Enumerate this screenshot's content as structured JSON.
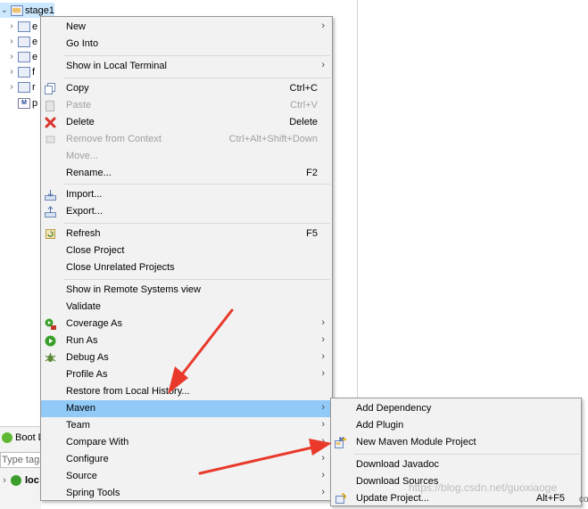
{
  "tree": {
    "root_label": "stage1",
    "items": [
      "e",
      "e",
      "e",
      "f",
      "r",
      "p"
    ]
  },
  "bottom": {
    "boot_tab": "Boot D",
    "type_tags_placeholder": "Type tags",
    "local_label": "loc"
  },
  "menu": {
    "new": {
      "label": "New"
    },
    "go_into": {
      "label": "Go Into"
    },
    "show_local_terminal": {
      "label": "Show in Local Terminal"
    },
    "copy": {
      "label": "Copy",
      "accel": "Ctrl+C"
    },
    "paste": {
      "label": "Paste",
      "accel": "Ctrl+V"
    },
    "delete": {
      "label": "Delete",
      "accel": "Delete"
    },
    "remove_context": {
      "label": "Remove from Context",
      "accel": "Ctrl+Alt+Shift+Down"
    },
    "move": {
      "label": "Move..."
    },
    "rename": {
      "label": "Rename...",
      "accel": "F2"
    },
    "import": {
      "label": "Import..."
    },
    "export": {
      "label": "Export..."
    },
    "refresh": {
      "label": "Refresh",
      "accel": "F5"
    },
    "close_project": {
      "label": "Close Project"
    },
    "close_unrelated": {
      "label": "Close Unrelated Projects"
    },
    "show_remote": {
      "label": "Show in Remote Systems view"
    },
    "validate": {
      "label": "Validate"
    },
    "coverage_as": {
      "label": "Coverage As"
    },
    "run_as": {
      "label": "Run As"
    },
    "debug_as": {
      "label": "Debug As"
    },
    "profile_as": {
      "label": "Profile As"
    },
    "restore_history": {
      "label": "Restore from Local History..."
    },
    "maven": {
      "label": "Maven"
    },
    "team": {
      "label": "Team"
    },
    "compare_with": {
      "label": "Compare With"
    },
    "configure": {
      "label": "Configure"
    },
    "source": {
      "label": "Source"
    },
    "spring_tools": {
      "label": "Spring Tools"
    }
  },
  "maven_submenu": {
    "add_dependency": {
      "label": "Add Dependency"
    },
    "add_plugin": {
      "label": "Add Plugin"
    },
    "new_module": {
      "label": "New Maven Module Project"
    },
    "download_javadoc": {
      "label": "Download Javadoc"
    },
    "download_sources": {
      "label": "Download Sources"
    },
    "update_project": {
      "label": "Update Project...",
      "accel": "Alt+F5"
    }
  },
  "watermark": "https://blog.csdn.net/guoxiaoge",
  "trailing_text": "co",
  "colors": {
    "menu_bg": "#f2f2f2",
    "highlight": "#91c9f7",
    "arrow": "#e8392b",
    "disabled_text": "#a0a0a0"
  }
}
